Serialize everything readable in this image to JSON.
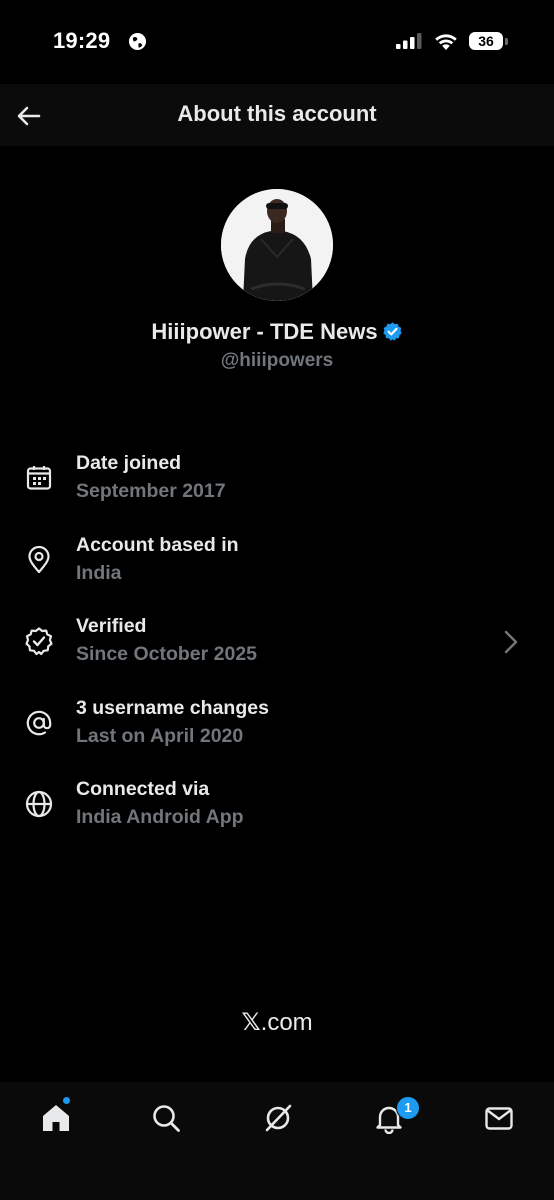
{
  "status_bar": {
    "time": "19:29",
    "battery": "36"
  },
  "header": {
    "title": "About this account"
  },
  "profile": {
    "name": "Hiiipower - TDE News",
    "handle": "@hiiipowers"
  },
  "info_rows": [
    {
      "label": "Date joined",
      "value": "September 2017",
      "icon": "calendar-icon"
    },
    {
      "label": "Account based in",
      "value": "India",
      "icon": "location-pin-icon"
    },
    {
      "label": "Verified",
      "value": "Since October 2025",
      "icon": "verified-check-icon"
    },
    {
      "label": "3 username changes",
      "value": "Last on April 2020",
      "icon": "at-sign-icon"
    },
    {
      "label": "Connected via",
      "value": "India Android App",
      "icon": "globe-icon"
    }
  ],
  "footer": {
    "brand_mark": "𝕏",
    "brand_suffix": ".com"
  },
  "bottom_nav": {
    "items": [
      "home-icon",
      "search-icon",
      "grok-icon",
      "notifications-icon",
      "messages-icon"
    ],
    "notifications_count": "1"
  },
  "colors": {
    "background": "#000000",
    "primary_text": "#e7e9ea",
    "secondary_text": "#71767b",
    "accent": "#1d9bf0"
  }
}
